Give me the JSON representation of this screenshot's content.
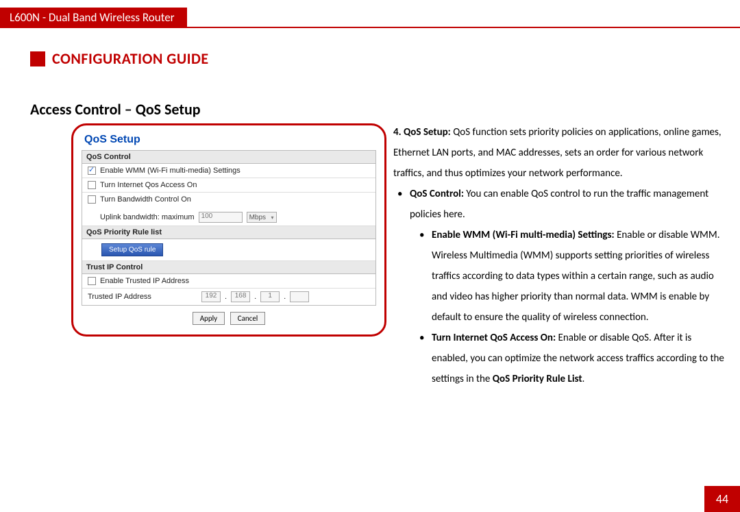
{
  "header": {
    "product": "L600N - Dual Band Wireless Router"
  },
  "section": {
    "title": "CONFIGURATION GUIDE"
  },
  "subheading": "Access Control – QoS Setup",
  "page_number": "44",
  "screenshot": {
    "title": "QoS Setup",
    "qos_control": {
      "header": "QoS Control",
      "wmm": {
        "label": "Enable WMM (Wi-Fi multi-media) Settings",
        "checked": true
      },
      "internet": {
        "label": "Turn Internet Qos Access On",
        "checked": false
      },
      "bw": {
        "label": "Turn Bandwidth Control On",
        "checked": false,
        "uplink_label": "Uplink bandwidth: maximum",
        "uplink_value": "100",
        "uplink_unit": "Mbps"
      }
    },
    "priority": {
      "header": "QoS Priority Rule list",
      "setup_btn": "Setup QoS rule"
    },
    "trust": {
      "header": "Trust IP Control",
      "enable": {
        "label": "Enable Trusted IP Address",
        "checked": false
      },
      "row_label": "Trusted IP Address",
      "ip": [
        "192",
        "168",
        "1",
        ""
      ]
    },
    "buttons": {
      "apply": "Apply",
      "cancel": "Cancel"
    }
  },
  "desc": {
    "lead_num": "4. QoS Setup:",
    "lead_txt": " QoS function sets priority policies on applications, online games, Ethernet LAN ports, and MAC addresses, sets an order for various network traffics, and thus optimizes your network performance.",
    "b1_title": "QoS Control:",
    "b1_txt": " You can enable QoS control to run the traffic management policies here.",
    "b2a_title": "Enable WMM (Wi-Fi multi-media) Settings:",
    "b2a_txt": " Enable or disable WMM. Wireless Multimedia (WMM) supports setting priorities of wireless traffics according to data types within a certain range, such as audio and video has higher priority than normal data. WMM is enable by default to ensure the quality of wireless connection.",
    "b2b_title": "Turn Internet QoS Access On:",
    "b2b_txt": " Enable or disable QoS. After it is enabled, you can optimize the network access traffics according to the settings in the ",
    "b2b_tail_bold": "QoS Priority Rule List",
    "b2b_tail_dot": "."
  }
}
